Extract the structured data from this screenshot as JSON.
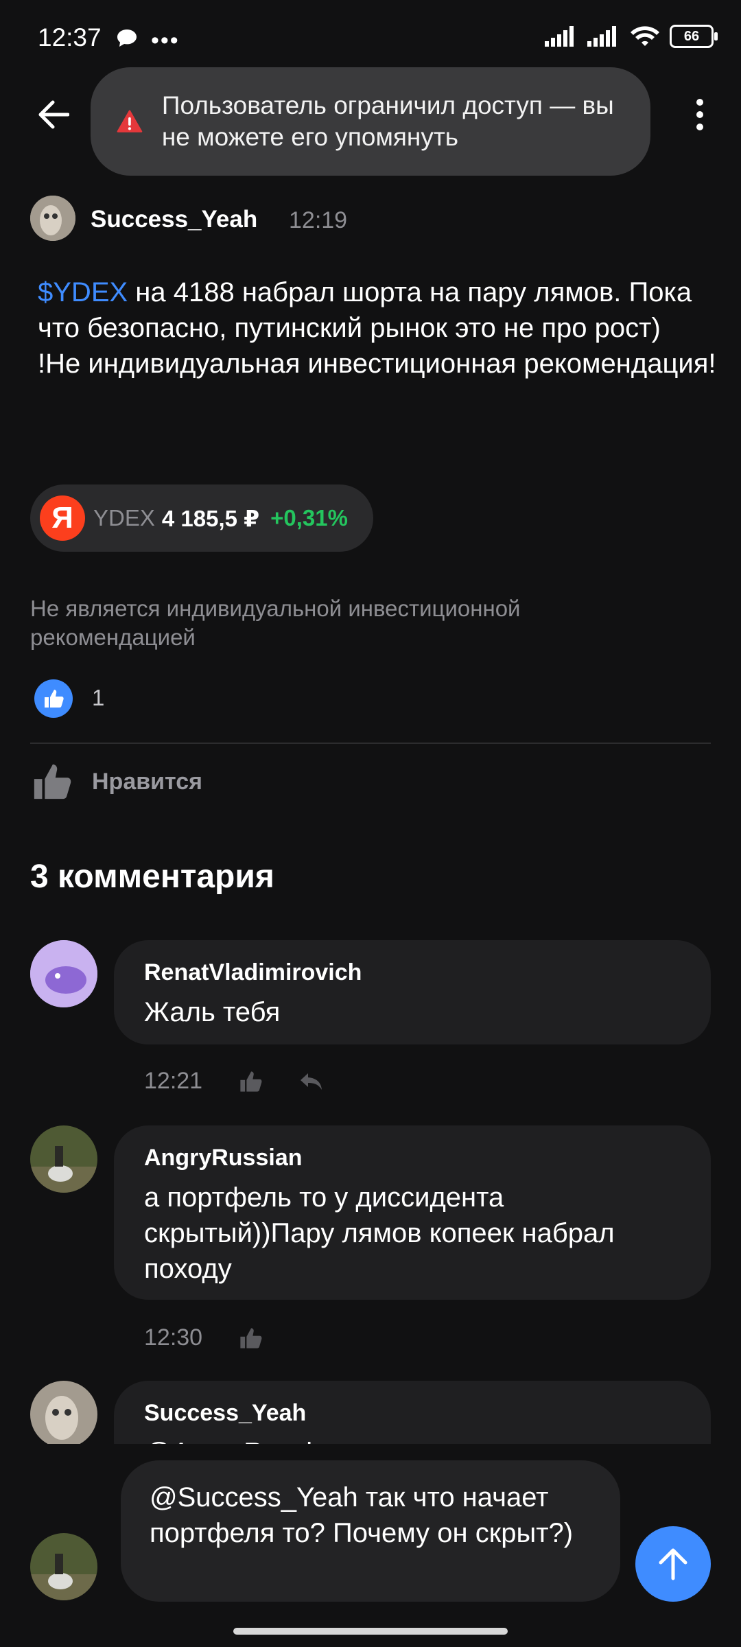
{
  "status_bar": {
    "time": "12:37",
    "battery": "66"
  },
  "header": {
    "toast_text": "Пользователь ограничил доступ — вы не можете его упомянуть"
  },
  "post": {
    "author": "Success_Yeah",
    "time": "12:19",
    "ticker_link": "$YDEX",
    "text_rest": " на 4188 набрал шорта на пару лямов. Пока что безопасно, путинский рынок это не про рост)\n!Не индивидуальная инвестиционная рекомендация!",
    "chip": {
      "logo": "Я",
      "ticker": "YDEX",
      "price": "4 185,5 ₽",
      "change": "+0,31%"
    },
    "disclaimer": "Не является индивидуальной инвестиционной рекомендацией",
    "likes_count": "1",
    "like_action_label": "Нравится"
  },
  "comments_title": "3 комментария",
  "comments": [
    {
      "author": "RenatVladimirovich",
      "text": "Жаль тебя",
      "time": "12:21"
    },
    {
      "author": "AngryRussian",
      "text": "а портфель то у диссидента скрытый))Пару лямов копеек набрал походу",
      "time": "12:30"
    },
    {
      "author": "Success_Yeah",
      "text": "@AngryRussian"
    }
  ],
  "composer": {
    "text": "@Success_Yeah так что начает портфеля то? Почему он скрыт?)"
  },
  "colors": {
    "accent": "#3f8cff",
    "positive": "#24c55e",
    "background": "#111112",
    "bubble": "#1f1f21"
  }
}
